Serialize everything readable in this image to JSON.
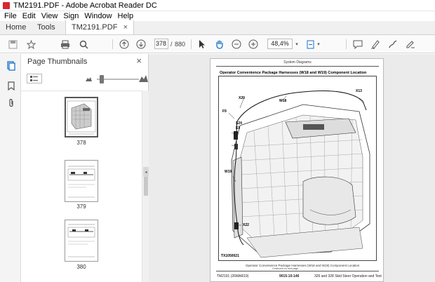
{
  "window": {
    "title": "TM2191.PDF - Adobe Acrobat Reader DC"
  },
  "menu": [
    "File",
    "Edit",
    "View",
    "Sign",
    "Window",
    "Help"
  ],
  "tabs": {
    "home": "Home",
    "tools": "Tools",
    "document": "TM2191.PDF",
    "close": "×"
  },
  "toolbar": {
    "current_page": "378",
    "page_separator": "/",
    "page_count": "880",
    "zoom": "48,4%",
    "icons": [
      "save-icon",
      "star-icon",
      "print-icon",
      "search-icon",
      "page-up-icon",
      "page-down-icon",
      "select-arrow-icon",
      "hand-icon",
      "zoom-out-icon",
      "zoom-in-icon",
      "zoom-dropdown-icon",
      "fit-page-icon",
      "comment-icon",
      "highlight-icon",
      "draw-icon",
      "sign-icon"
    ]
  },
  "thumbnails_panel": {
    "title": "Page Thumbnails",
    "close": "×",
    "pages": [
      "378",
      "379",
      "380"
    ]
  },
  "document": {
    "header": "System Diagrams",
    "title": "Operator Convenience Package Harnesses (W18 and W19) Component Location",
    "callouts": {
      "x13": "X13",
      "x20": "X20",
      "w18": "W18",
      "f9": "F9",
      "s24": "S24",
      "e9": "E9",
      "w19": "W19",
      "x22": "X22"
    },
    "figure_id": "TX1050021",
    "caption": "Operator Convenience Package Harnesses (W18 and W19) Component Location",
    "continued": "Continued on next page",
    "footer_left": "TM2191 (26MAR19)",
    "footer_center": "9015-10-146",
    "footer_right": "326 and 328 Skid Steer Operation and Test"
  },
  "colors": {
    "adobe_red": "#d7282f",
    "viewer_bg": "#ebebeb",
    "accent_blue": "#1a73c8"
  }
}
